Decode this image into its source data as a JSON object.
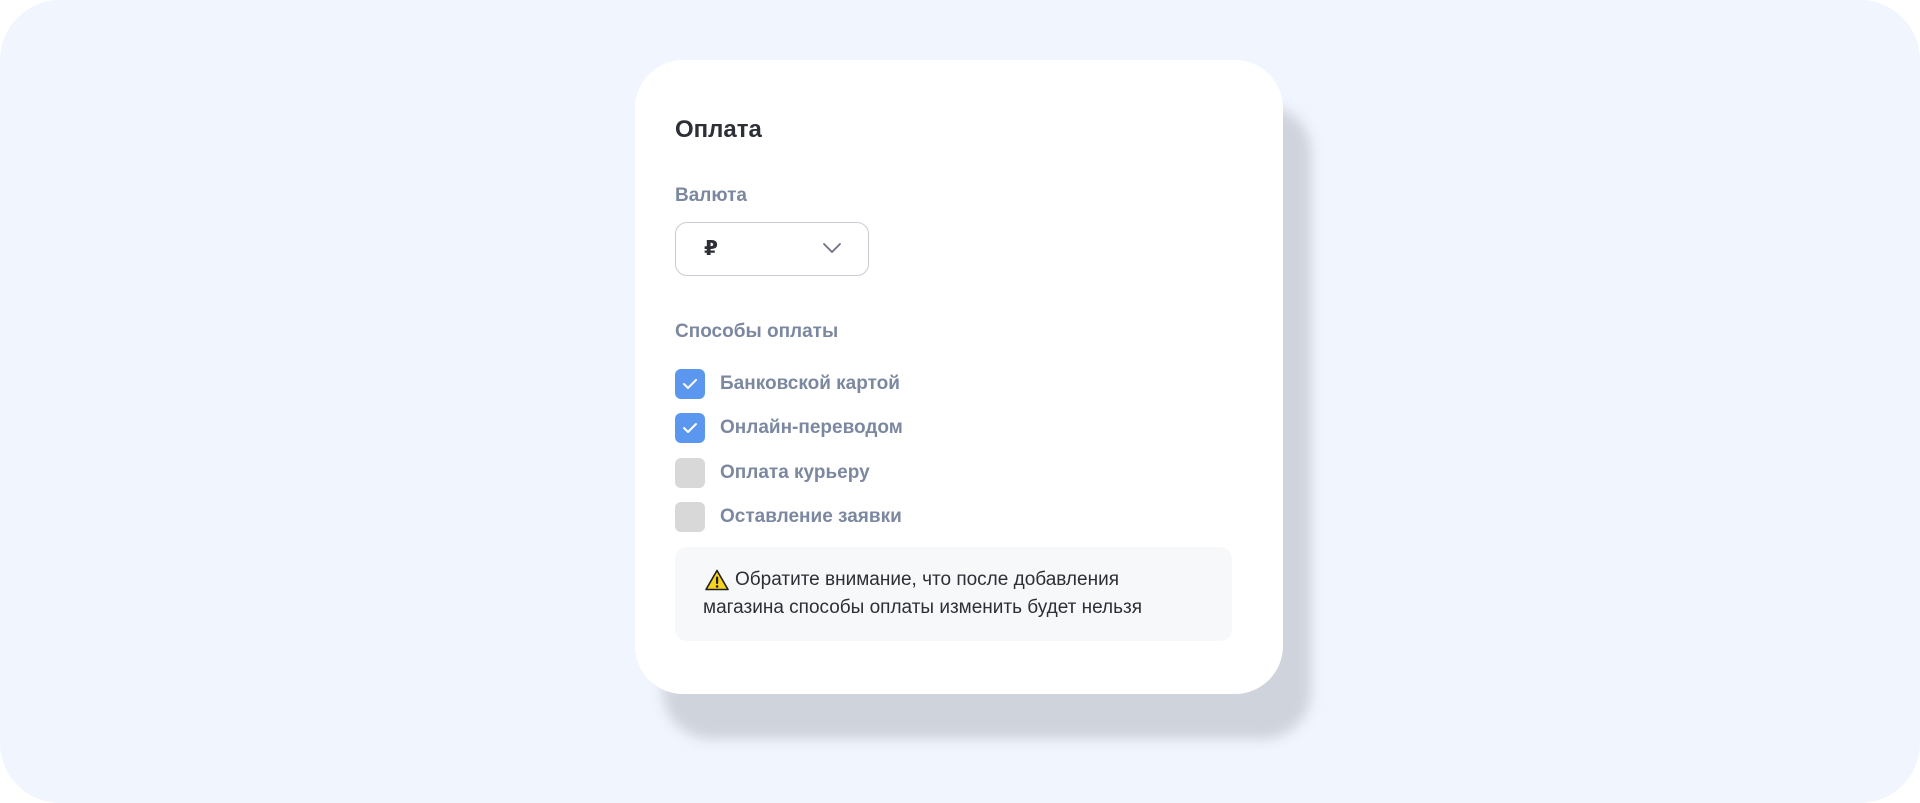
{
  "payment": {
    "title": "Оплата",
    "currency": {
      "label": "Валюта",
      "selected": "₽"
    },
    "methods": {
      "label": "Способы оплаты",
      "items": [
        {
          "label": "Банковской картой",
          "checked": true
        },
        {
          "label": "Онлайн-переводом",
          "checked": true
        },
        {
          "label": "Оплата курьеру",
          "checked": false
        },
        {
          "label": "Оставление заявки",
          "checked": false
        }
      ]
    },
    "notice": {
      "icon": "warning-icon",
      "line1": "Обратите внимание, что после добавления",
      "line2": "магазина способы оплаты изменить будет нельзя"
    }
  },
  "colors": {
    "background": "#f0f5fe",
    "card": "#ffffff",
    "checkbox_checked": "#5b97ee",
    "checkbox_unchecked": "#d8d8d8",
    "label_muted": "#7c88a0",
    "text_dark": "#2c2f36"
  }
}
